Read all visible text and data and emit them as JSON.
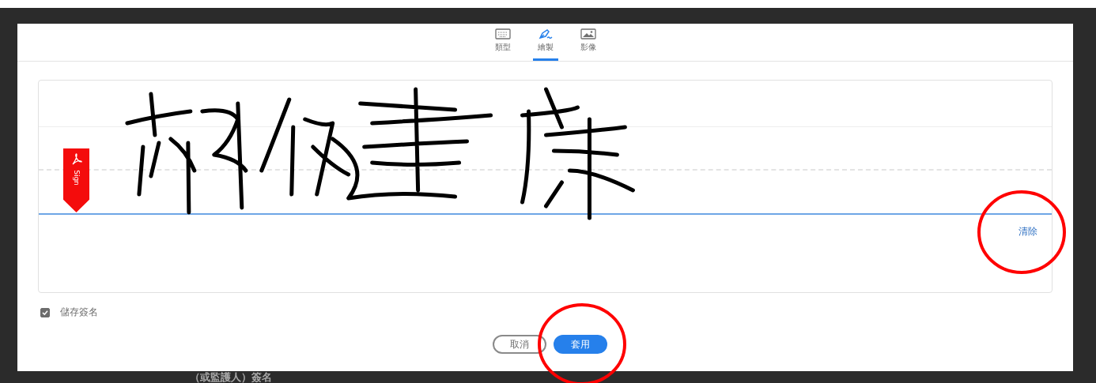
{
  "tabs": [
    {
      "label": "類型",
      "kind": "keyboard",
      "selected": false
    },
    {
      "label": "繪製",
      "kind": "pen",
      "selected": true
    },
    {
      "label": "影像",
      "kind": "image",
      "selected": false
    }
  ],
  "signature_pad": {
    "sign_tag_label": "Sign",
    "clear_label": "清除"
  },
  "save_signature": {
    "label": "儲存簽名",
    "checked": true
  },
  "buttons": [
    {
      "label": "取消",
      "kind": "secondary"
    },
    {
      "label": "套用",
      "kind": "primary"
    }
  ],
  "document_text": "（或監護人）簽名"
}
